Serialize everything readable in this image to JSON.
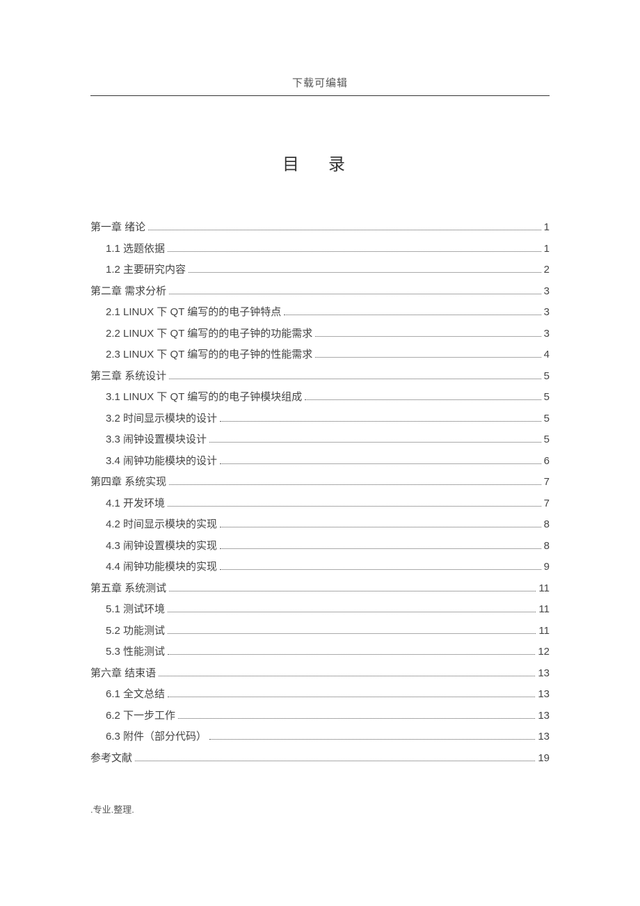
{
  "header": "下载可编辑",
  "title": "目  录",
  "footer": ".专业.整理.",
  "toc": [
    {
      "label": "第一章  绪论",
      "page": "1",
      "level": 0
    },
    {
      "label": "1.1 选题依据",
      "page": "1",
      "level": 1
    },
    {
      "label": "1.2 主要研究内容",
      "page": "2",
      "level": 1
    },
    {
      "label": "第二章  需求分析",
      "page": "3",
      "level": 0
    },
    {
      "label": "2.1 LINUX 下 QT 编写的的电子钟特点",
      "page": "3",
      "level": 1
    },
    {
      "label": "2.2 LINUX 下 QT 编写的的电子钟的功能需求",
      "page": "3",
      "level": 1
    },
    {
      "label": "2.3 LINUX 下 QT 编写的的电子钟的性能需求",
      "page": "4",
      "level": 1
    },
    {
      "label": "第三章  系统设计",
      "page": "5",
      "level": 0
    },
    {
      "label": "3.1 LINUX 下 QT 编写的的电子钟模块组成",
      "page": "5",
      "level": 1
    },
    {
      "label": "3.2 时间显示模块的设计",
      "page": "5",
      "level": 1
    },
    {
      "label": "3.3 闹钟设置模块设计",
      "page": "5",
      "level": 1
    },
    {
      "label": "3.4 闹钟功能模块的设计",
      "page": "6",
      "level": 1
    },
    {
      "label": "第四章  系统实现",
      "page": "7",
      "level": 0
    },
    {
      "label": "4.1 开发环境",
      "page": "7",
      "level": 1
    },
    {
      "label": "4.2 时间显示模块的实现",
      "page": "8",
      "level": 1
    },
    {
      "label": "4.3 闹钟设置模块的实现",
      "page": "8",
      "level": 1
    },
    {
      "label": "4.4 闹钟功能模块的实现",
      "page": "9",
      "level": 1
    },
    {
      "label": "第五章  系统测试",
      "page": "11",
      "level": 0
    },
    {
      "label": "5.1 测试环境",
      "page": "11",
      "level": 1
    },
    {
      "label": "5.2 功能测试",
      "page": "11",
      "level": 1
    },
    {
      "label": "5.3 性能测试",
      "page": "12",
      "level": 1
    },
    {
      "label": "第六章  结束语",
      "page": "13",
      "level": 0
    },
    {
      "label": "6.1 全文总结",
      "page": "13",
      "level": 1
    },
    {
      "label": "6.2 下一步工作",
      "page": "13",
      "level": 1
    },
    {
      "label": "6.3 附件（部分代码）",
      "page": "13",
      "level": 1
    },
    {
      "label": "参考文献",
      "page": "19",
      "level": 0
    }
  ]
}
